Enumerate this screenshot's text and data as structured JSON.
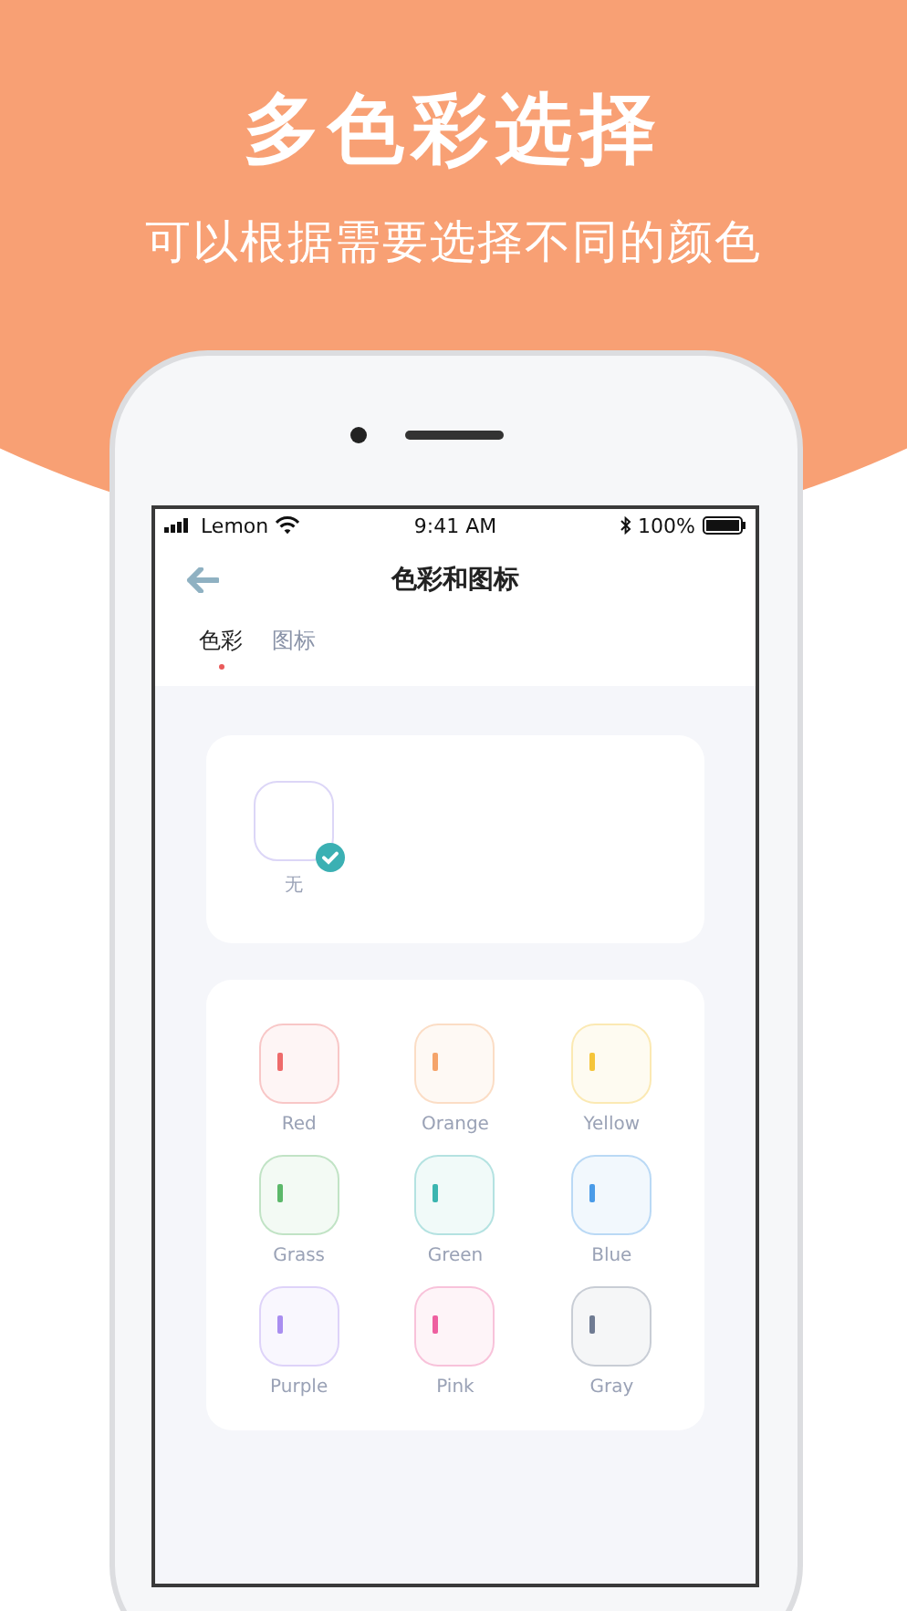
{
  "banner": {
    "title": "多色彩选择",
    "subtitle": "可以根据需要选择不同的颜色"
  },
  "status_bar": {
    "carrier": "Lemon",
    "time": "9:41 AM",
    "battery": "100%"
  },
  "nav": {
    "title": "色彩和图标"
  },
  "tabs": [
    {
      "label": "色彩",
      "selected": true
    },
    {
      "label": "图标",
      "selected": false
    }
  ],
  "none_option": {
    "label": "无",
    "selected": true
  },
  "colors": [
    {
      "label": "Red",
      "color": "#ee6b6b",
      "selected": false
    },
    {
      "label": "Orange",
      "color": "#f5a46a",
      "selected": false
    },
    {
      "label": "Yellow",
      "color": "#f5c53a",
      "selected": false
    },
    {
      "label": "Grass",
      "color": "#5cb86a",
      "selected": false
    },
    {
      "label": "Green",
      "color": "#3bb5b0",
      "selected": false
    },
    {
      "label": "Blue",
      "color": "#4a9be8",
      "selected": false
    },
    {
      "label": "Purple",
      "color": "#a98ef0",
      "selected": false
    },
    {
      "label": "Pink",
      "color": "#ee5fa0",
      "selected": false
    },
    {
      "label": "Gray",
      "color": "#6f7b92",
      "selected": false
    }
  ]
}
